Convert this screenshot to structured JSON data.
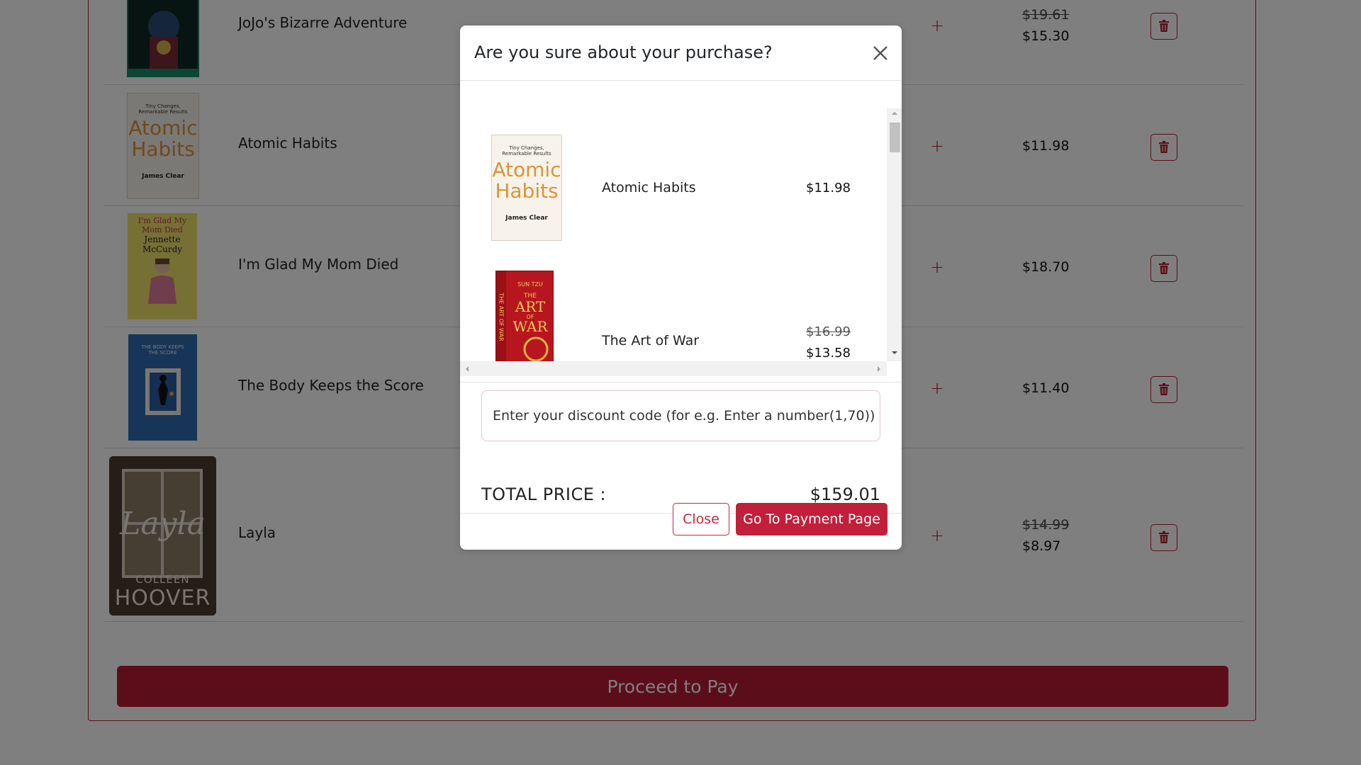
{
  "colors": {
    "accent": "#b71c34",
    "button_primary": "#c21f3a",
    "overlay": "rgba(0,0,0,0.5)"
  },
  "cart": {
    "items": [
      {
        "title": "JoJo's Bizarre Adventure",
        "old_price": "$19.61",
        "price": "$15.30"
      },
      {
        "title": "Atomic Habits",
        "price": "$11.98"
      },
      {
        "title": "I'm Glad My Mom Died",
        "price": "$18.70"
      },
      {
        "title": "The Body Keeps the Score",
        "price": "$11.40"
      },
      {
        "title": "Layla",
        "old_price": "$14.99",
        "price": "$8.97"
      }
    ],
    "plus_symbol": "+",
    "proceed_label": "Proceed to Pay"
  },
  "covers": {
    "atomic": {
      "line1": "Tiny Changes,",
      "line2": "Remarkable Results",
      "word1": "Atomic",
      "word2": "Habits",
      "author": "James Clear"
    },
    "glad": {
      "line1": "I'm Glad My",
      "line2": "Mom Died",
      "author1": "Jennette",
      "author2": "McCurdy"
    },
    "body": {
      "line1": "THE BODY KEEPS",
      "line2": "THE SCORE"
    },
    "layla": {
      "title": "Layla",
      "author1": "COLLEEN",
      "author2": "HOOVER"
    },
    "artofwar": {
      "author": "SUN TZU",
      "word1": "THE",
      "word2": "ART",
      "word3": "OF",
      "word4": "WAR",
      "spine": "THE ART OF WAR"
    }
  },
  "modal": {
    "title": "Are you sure about your purchase?",
    "items": [
      {
        "title": "Atomic Habits",
        "price": "$11.98"
      },
      {
        "title": "The Art of War",
        "old_price": "$16.99",
        "price": "$13.58"
      }
    ],
    "discount_placeholder": "Enter your discount code (for e.g. Enter a number(1,70))",
    "total_label": "TOTAL PRICE :",
    "total_value": "$159.01",
    "close_label": "Close",
    "pay_label": "Go To Payment Page"
  },
  "icons": {
    "trash": "trash-icon",
    "close": "close-icon",
    "plus": "plus-icon"
  }
}
